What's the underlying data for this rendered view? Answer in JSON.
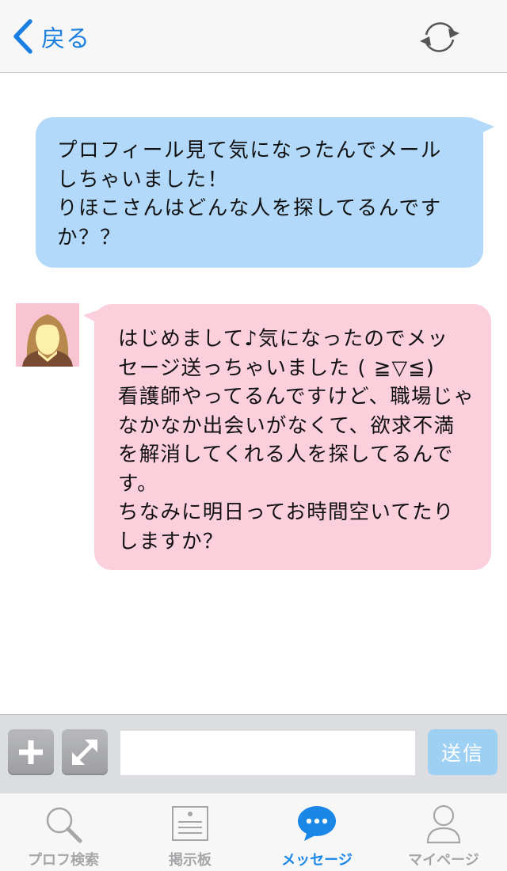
{
  "header": {
    "back_label": "戻る",
    "back_icon": "chevron-left-icon",
    "refresh_icon": "refresh-icon"
  },
  "messages": [
    {
      "direction": "outgoing",
      "text": "プロフィール見て気になったんでメール\nしちゃいました！\nりほこさんはどんな人を探してるんです\nか？？"
    },
    {
      "direction": "incoming",
      "text": "はじめまして♪気になったのでメッ\nセージ送っちゃいました ( ≧▽≦)\n看護師やってるんですけど、職場じゃ\nなかなか出会いがなくて、欲求不満\nを解消してくれる人を探してるんで\nす。\nちなみに明日ってお時間空いてたり\nしますか？"
    }
  ],
  "input": {
    "value": "",
    "placeholder": "",
    "send_label": "送信"
  },
  "tabs": [
    {
      "label": "プロフ検索",
      "icon": "search-icon",
      "active": false
    },
    {
      "label": "掲示板",
      "icon": "board-icon",
      "active": false
    },
    {
      "label": "メッセージ",
      "icon": "message-icon",
      "active": true
    },
    {
      "label": "マイページ",
      "icon": "user-icon",
      "active": false
    }
  ],
  "colors": {
    "accent": "#1a86e6",
    "outgoing_bubble": "#b2d9f9",
    "incoming_bubble": "#fccfdd",
    "send_button": "#9dd0f2"
  }
}
